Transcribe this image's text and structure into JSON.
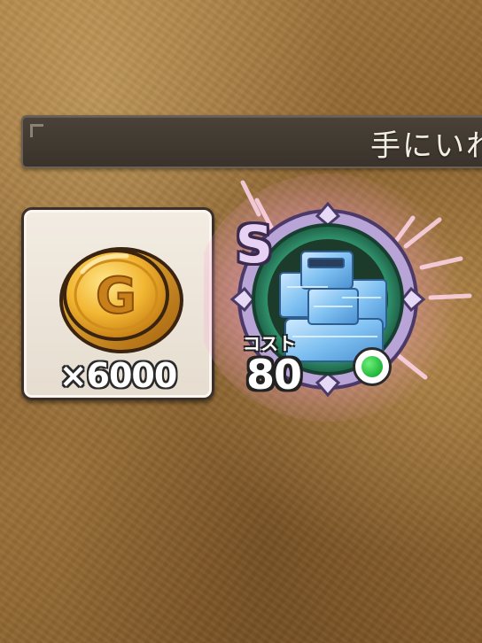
{
  "header": {
    "title": "手にいれ"
  },
  "reward_gold": {
    "icon": "gold-coin-icon",
    "coin_letter": "G",
    "quantity_label": "×6000",
    "colors": {
      "coin": "#e0a020",
      "card_bg": "#efe7dc"
    }
  },
  "reward_monster": {
    "rank": "S",
    "cost_label": "コスト",
    "cost_value": "80",
    "type_indicator_color": "#21b53a",
    "icon": "ice-golem-monster-icon"
  }
}
